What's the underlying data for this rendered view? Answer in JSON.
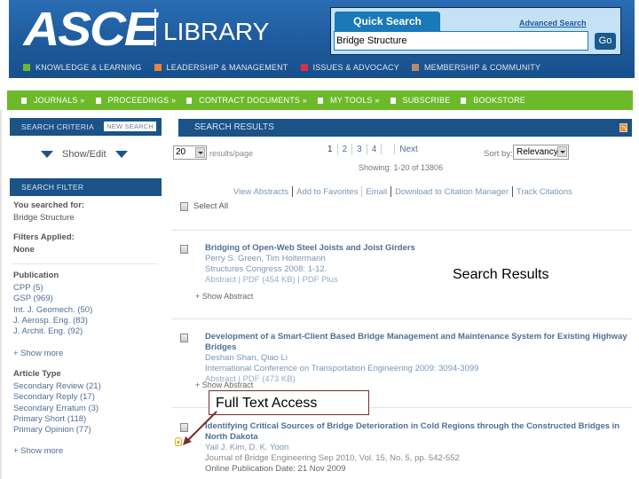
{
  "header": {
    "logo_main": "ASCE",
    "logo_sub": "LIBRARY",
    "top_nav": [
      {
        "label": "KNOWLEDGE & LEARNING",
        "color": "#6cba2a"
      },
      {
        "label": "LEADERSHIP & MANAGEMENT",
        "color": "#e8833a"
      },
      {
        "label": "ISSUES & ADVOCACY",
        "color": "#d8304a"
      },
      {
        "label": "MEMBERSHIP & COMMUNITY",
        "color": "#b88a6a"
      }
    ]
  },
  "quick_search": {
    "tab_label": "Quick Search",
    "advanced_link": "Advanced Search",
    "query": "Bridge Structure",
    "go_label": "Go"
  },
  "green_nav": [
    {
      "label": "JOURNALS »"
    },
    {
      "label": "PROCEEDINGS »"
    },
    {
      "label": "CONTRACT DOCUMENTS »"
    },
    {
      "label": "MY TOOLS »"
    },
    {
      "label": "SUBSCRIBE"
    },
    {
      "label": "BOOKSTORE"
    }
  ],
  "sidebar": {
    "criteria_title": "SEARCH CRITERIA",
    "new_search": "NEW SEARCH",
    "show_edit": "Show/Edit",
    "filter_title": "SEARCH FILTER",
    "searched_for_label": "You searched for:",
    "searched_for_value": "Bridge Structure",
    "filters_applied_label": "Filters Applied:",
    "filters_applied_value": "None",
    "publication_label": "Publication",
    "publications": [
      "CPP (5)",
      "GSP (969)",
      "Int. J. Geomech. (50)",
      "J. Aerosp. Eng. (83)",
      "J. Archit. Eng. (92)"
    ],
    "show_more_1": "+ Show more",
    "article_type_label": "Article Type",
    "article_types": [
      "Secondary Review (21)",
      "Secondary Reply (17)",
      "Secondary Erratum (3)",
      "Primary Short (118)",
      "Primary Opinion (77)"
    ],
    "show_more_2": "+ Show more"
  },
  "results": {
    "title": "SEARCH RESULTS",
    "per_page_value": "20",
    "per_page_label": "results/page",
    "pages": [
      "1",
      "2",
      "3",
      "4"
    ],
    "current_page": "1",
    "next_label": "Next",
    "showing": "Showing: 1-20 of 13806",
    "sort_label": "Sort by:",
    "sort_value": "Relevancy",
    "actions": [
      "View Abstracts",
      "Add to Favorites",
      "Email",
      "Download to Citation Manager",
      "Track Citations"
    ],
    "select_all": "Select All",
    "items": [
      {
        "title": "Bridging of Open-Web Steel Joists and Joist Girders",
        "authors": "Perry S. Green, Tim Holtermann",
        "source": "Structures Congress 2008: 1-12.",
        "links": "Abstract | PDF (454 KB) | PDF Plus",
        "show_abstract": "+ Show Abstract"
      },
      {
        "title": "Development of a Smart-Client Based Bridge Management and Maintenance System for Existing Highway Bridges",
        "authors": "Deshan Shan, Qiao Li",
        "source": "International Conference on Transportation Engineering 2009: 3094-3099",
        "links": "Abstract | PDF (473 KB)",
        "show_abstract": "+ Show Abstract"
      },
      {
        "title": "Identifying Critical Sources of Bridge Deterioration in Cold Regions through the Constructed Bridges in North Dakota",
        "authors": "Yail J. Kim, D. K. Yoon",
        "source": "Journal of Bridge Engineering Sep 2010, Vol. 15, No. 5, pp. 542-552",
        "date": "Online Publication Date: 21 Nov 2009"
      }
    ]
  },
  "annotations": {
    "search_results": "Search Results",
    "full_text_access": "Full Text Access",
    "arrow_color": "#7a2b2b"
  }
}
